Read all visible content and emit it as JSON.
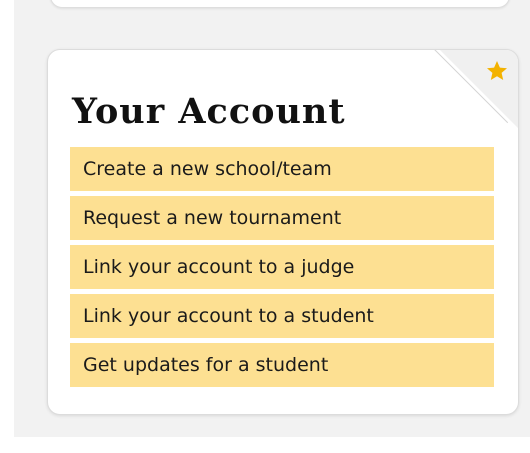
{
  "account_card": {
    "title": "Your Account",
    "links": [
      {
        "label": "Create a new school/team"
      },
      {
        "label": "Request a new tournament"
      },
      {
        "label": "Link your account to a judge"
      },
      {
        "label": "Link your account to a student"
      },
      {
        "label": "Get updates for a student"
      }
    ]
  },
  "icons": {
    "corner": "star-icon"
  },
  "colors": {
    "link_background": "#fde092",
    "star": "#f3b200",
    "panel_background": "#f2f2f2"
  }
}
